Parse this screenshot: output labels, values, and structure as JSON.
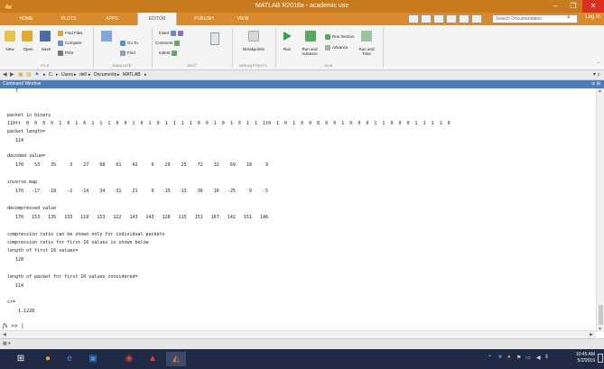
{
  "window": {
    "title": "MATLAB R2018a - academic use",
    "min_glyph": "–",
    "max_glyph": "❐",
    "close_glyph": "✕"
  },
  "tabs": [
    {
      "label": "HOME",
      "active": false
    },
    {
      "label": "PLOTS",
      "active": false
    },
    {
      "label": "APPS",
      "active": false
    },
    {
      "label": "EDITOR",
      "active": true
    },
    {
      "label": "PUBLISH",
      "active": false
    },
    {
      "label": "VIEW",
      "active": false
    }
  ],
  "search": {
    "placeholder": "Search Documentation"
  },
  "login": "Log In",
  "ribbon": {
    "file": {
      "new": "New",
      "open": "Open",
      "save": "Save",
      "find_files": "Find Files",
      "compare": "Compare",
      "print": "Print",
      "group": "FILE"
    },
    "navigate": {
      "comment": "Comment",
      "go_to": "Go To",
      "find": "Find",
      "insert": "Insert",
      "indent": "Indent",
      "group": "NAVIGATE",
      "edit_group": "EDIT"
    },
    "breakpoints": {
      "label": "Breakpoints",
      "group": "BREAKPOINTS"
    },
    "run": {
      "run": "Run",
      "run_and_advance": "Run and Advance",
      "run_section": "Run Section",
      "advance": "Advance",
      "run_and_time": "Run and Time",
      "group": "RUN"
    }
  },
  "breadcrumb": [
    "C:",
    "Users",
    "dell",
    "Documents",
    "MATLAB"
  ],
  "command_window": {
    "title": "Command Window",
    "lines": [
      "   7",
      "",
      "packet in binary",
      "110tt  0  0  0  0  1  0  1  0  1  1  1  0  0  1  0  1  0  1  1  1  1  0  0  1  0  1  0  1  1  1t0  1  0  1  0  0  0  0  0  1  0  0  0  1  1  0  0  0  1  1  1  1  0",
      "packet length=",
      "   114",
      "",
      "decoded value=",
      "   170    53    35     3    27    68    61    42     0    29    25    72    32    69    18     9",
      "",
      "inverse map",
      "   170   -17   -18    -2   -14    34   -31    21     0   -15   -13    36    16   -25     9    -5",
      "",
      "decompressed value",
      "   170   153   135   133   119   153   122   143   143   128   115   151   167   142   151   146",
      "",
      "compression ratio can be shown only for individual packets",
      "compression ratio for first 16 values is shown below",
      "length of first 16 values=",
      "   128",
      "",
      "length of packet for first 16 values considered=",
      "   114",
      "",
      "cr=",
      "    1.1228"
    ],
    "prompt": ">>"
  },
  "clock": {
    "time": "10:45 AM",
    "date": "5/2/2019"
  },
  "colors": {
    "titlebar": "#c87a1e",
    "tabs": "#d98a2b",
    "command_header": "#4a7cbf",
    "taskbar": "#1f2a44"
  }
}
